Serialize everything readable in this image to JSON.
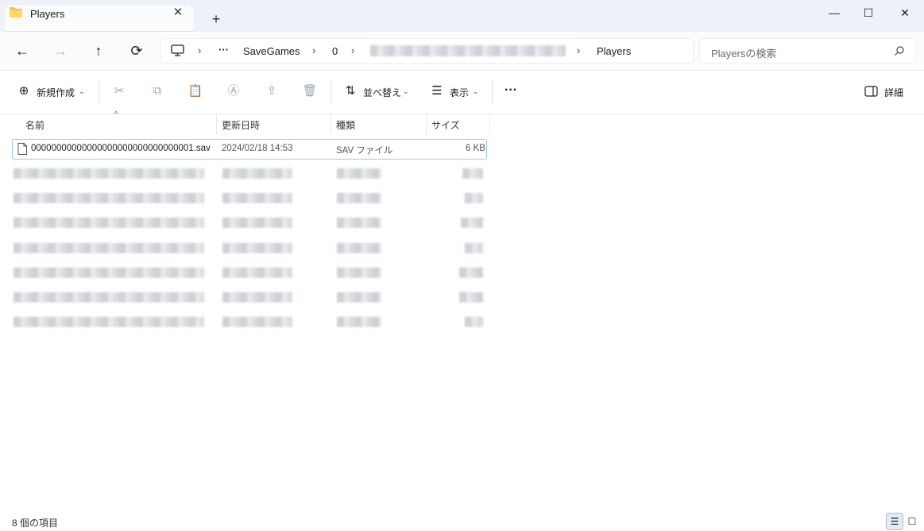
{
  "window": {
    "tab_title": "Players",
    "new_tab": "+",
    "tab_close": "✕",
    "minimize": "—",
    "maximize": "☐",
    "close": "✕"
  },
  "nav": {
    "back": "←",
    "forward": "→",
    "up": "↑",
    "refresh": "⟳",
    "breadcrumb": {
      "monitor_icon": "monitor-icon",
      "more": "···",
      "items": [
        "SaveGames",
        "0",
        "Players"
      ],
      "separator": "›"
    },
    "search_placeholder": "Playersの検索"
  },
  "toolbar": {
    "new": "新規作成",
    "sort": "並べ替え",
    "view": "表示",
    "more": "···",
    "details": "詳細"
  },
  "columns": {
    "name": "名前",
    "modified": "更新日時",
    "type": "種類",
    "size": "サイズ"
  },
  "files": [
    {
      "name": "00000000000000000000000000000001.sav",
      "modified": "2024/02/18 14:53",
      "type": "SAV ファイル",
      "size": "6 KB"
    }
  ],
  "status": {
    "item_count": "8 個の項目"
  },
  "colors": {
    "tabbar": "#eef2f8",
    "accent": "#9ec4e6",
    "folder": "#f5c542"
  }
}
